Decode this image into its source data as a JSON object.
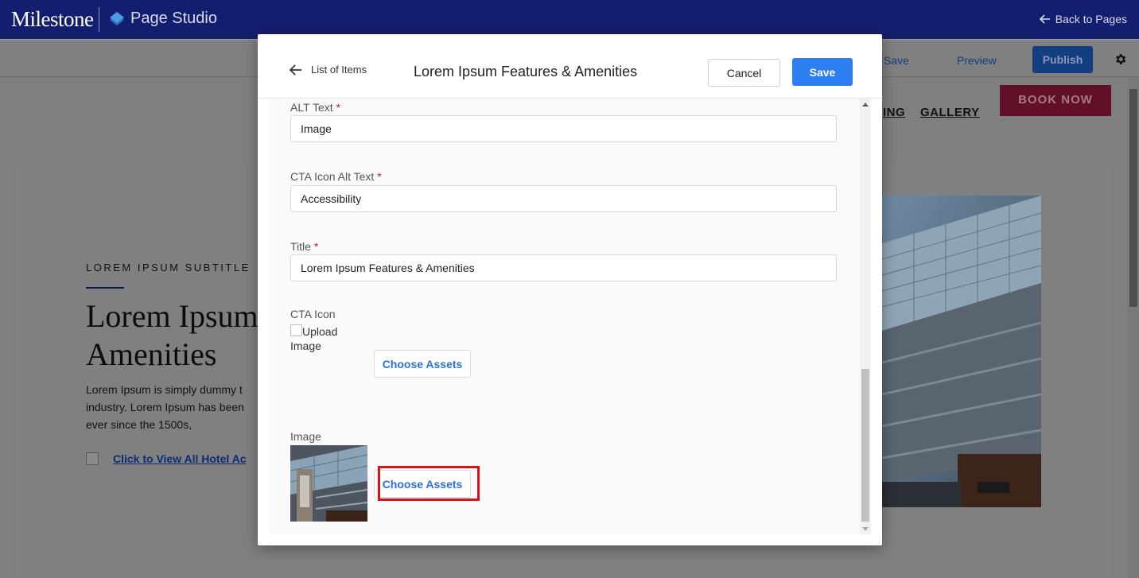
{
  "app": {
    "brand": "Milestone",
    "product": "Page Studio",
    "back_link": "Back to Pages"
  },
  "toolbar": {
    "save_label": "Save",
    "preview_label": "Preview",
    "publish_label": "Publish"
  },
  "preview": {
    "nav_partial": "ING",
    "nav_gallery": "GALLERY",
    "book_now": "BOOK NOW",
    "subtitle": "LOREM IPSUM SUBTITLE",
    "heading_line1": "Lorem Ipsum",
    "heading_line2": "Amenities",
    "body_line1": "Lorem Ipsum is simply dummy t",
    "body_line2": "industry. Lorem Ipsum has been",
    "body_line3": "ever since the 1500s,",
    "view_link": "Click to View All Hotel Ac"
  },
  "modal": {
    "back_label": "List of Items",
    "title": "Lorem Ipsum Features & Amenities",
    "cancel_label": "Cancel",
    "save_label": "Save",
    "fields": {
      "alt_text": {
        "label": "ALT Text",
        "value": "Image"
      },
      "cta_alt": {
        "label": "CTA Icon Alt Text",
        "value": "Accessibility"
      },
      "title": {
        "label": "Title",
        "value": "Lorem Ipsum Features & Amenities"
      }
    },
    "cta_icon": {
      "label": "CTA Icon",
      "upload_label": "Upload",
      "upload_label2": "Image",
      "choose_label": "Choose Assets"
    },
    "image": {
      "label": "Image",
      "choose_label": "Choose Assets"
    },
    "required_mark": "*"
  },
  "colors": {
    "topbar": "#141e6e",
    "primary_button": "#2d7ef0",
    "required": "#d0202c",
    "highlight": "#e0101a"
  },
  "icons": {
    "back_arrow": "arrow-left-icon",
    "settings": "gear-icon",
    "layers": "layers-icon"
  }
}
